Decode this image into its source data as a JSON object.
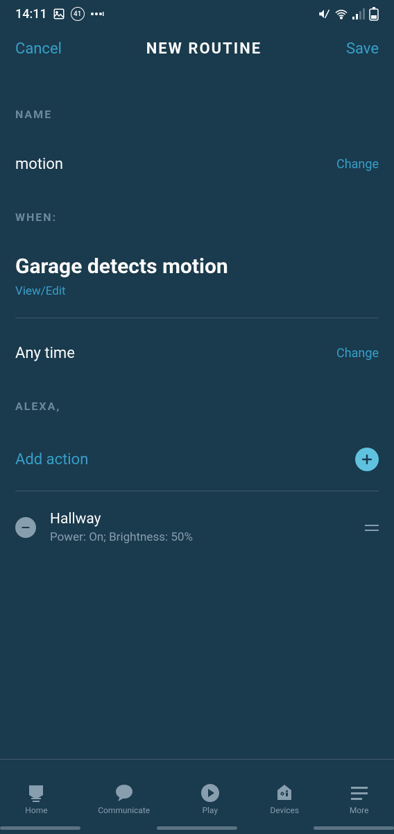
{
  "status": {
    "time": "14:11",
    "badge": "41"
  },
  "header": {
    "cancel": "Cancel",
    "title": "NEW ROUTINE",
    "save": "Save"
  },
  "sections": {
    "name_label": "NAME",
    "name_value": "motion",
    "name_change": "Change",
    "when_label": "WHEN:",
    "trigger_title": "Garage detects motion",
    "view_edit": "View/Edit",
    "anytime_text": "Any time",
    "anytime_change": "Change",
    "alexa_label": "ALEXA,",
    "add_action": "Add action"
  },
  "actions": [
    {
      "title": "Hallway",
      "subtitle": "Power: On; Brightness: 50%"
    }
  ],
  "nav": {
    "home": "Home",
    "communicate": "Communicate",
    "play": "Play",
    "devices": "Devices",
    "more": "More"
  }
}
